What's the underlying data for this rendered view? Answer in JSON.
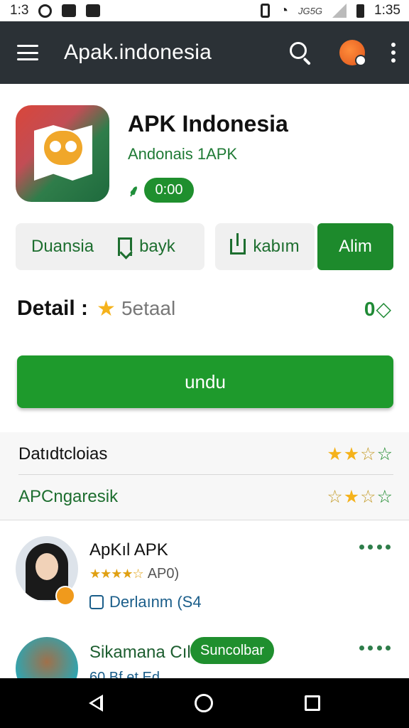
{
  "status_bar": {
    "time_left": "1:3",
    "network": "JG5G",
    "time": "1:35"
  },
  "app_bar": {
    "title": "Apak.indonesia",
    "icons": [
      "menu-icon",
      "search-icon",
      "profile-avatar-icon",
      "more-vert-icon"
    ]
  },
  "app": {
    "name": "APK Indonesia",
    "developer": "Andonais 1APK",
    "badge": "0:00",
    "logo": "map-pin-logo"
  },
  "actions": {
    "duansia": "Duansia",
    "bookmark": "bayk",
    "share": "kabım",
    "primary": "Alim"
  },
  "detail": {
    "label": "Detail :",
    "value": "5etaal",
    "code": "0◇"
  },
  "download": {
    "label": "undu"
  },
  "info_rows": [
    {
      "label": "Datıdtcloias",
      "stars": "★★☆☆"
    },
    {
      "label": "APCngaresik",
      "stars": "☆★☆☆"
    }
  ],
  "reviews": [
    {
      "name": "ApKıl APK",
      "rating_stars": "★★★★☆",
      "rating_text": "AP0)",
      "tag": "Derlaınm (S4"
    },
    {
      "name": "Sikamana Cıl",
      "chip": "Suncolbar",
      "sub": "60 Bf et Ed"
    }
  ],
  "colors": {
    "app_bar": "#2b3136",
    "primary_green": "#1e9a2c",
    "star": "#f5b21b"
  }
}
